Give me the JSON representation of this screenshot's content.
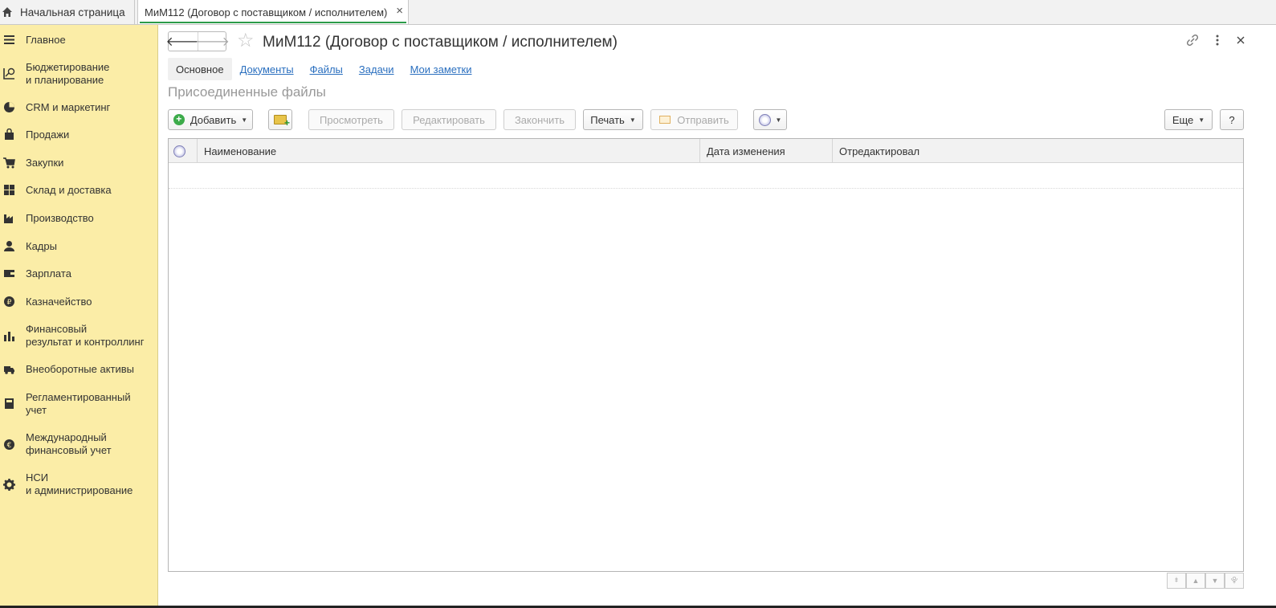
{
  "topbar": {
    "home_tab": "Начальная страница",
    "doc_tab": "МиМ112 (Договор с поставщиком / исполнителем)",
    "close": "×"
  },
  "sidebar": {
    "items": [
      {
        "label": "Главное",
        "icon": "menu-icon"
      },
      {
        "label": "Бюджетирование\nи планирование",
        "icon": "budget-icon"
      },
      {
        "label": "CRM и маркетинг",
        "icon": "pie-chart-icon"
      },
      {
        "label": "Продажи",
        "icon": "shopping-bag-icon"
      },
      {
        "label": "Закупки",
        "icon": "cart-icon"
      },
      {
        "label": "Склад и доставка",
        "icon": "warehouse-icon"
      },
      {
        "label": "Производство",
        "icon": "factory-icon"
      },
      {
        "label": "Кадры",
        "icon": "person-icon"
      },
      {
        "label": "Зарплата",
        "icon": "wallet-icon"
      },
      {
        "label": "Казначейство",
        "icon": "ruble-coin-icon"
      },
      {
        "label": "Финансовый\nрезультат и контроллинг",
        "icon": "bar-chart-icon"
      },
      {
        "label": "Внеоборотные активы",
        "icon": "truck-icon"
      },
      {
        "label": "Регламентированный\nучет",
        "icon": "calculator-icon"
      },
      {
        "label": "Международный\nфинансовый учет",
        "icon": "euro-coin-icon"
      },
      {
        "label": "НСИ\nи администрирование",
        "icon": "gear-icon"
      }
    ]
  },
  "header": {
    "back": "🡐",
    "forward": "🡒",
    "title": "МиМ112 (Договор с поставщиком / исполнителем)"
  },
  "tabs": [
    "Основное",
    "Документы",
    "Файлы",
    "Задачи",
    "Мои заметки"
  ],
  "section_title": "Присоединенные файлы",
  "toolbar": {
    "add": "Добавить",
    "view": "Просмотреть",
    "edit": "Редактировать",
    "finish": "Закончить",
    "print": "Печать",
    "send": "Отправить",
    "more": "Еще",
    "help": "?"
  },
  "grid": {
    "columns": [
      "Наименование",
      "Дата изменения",
      "Отредактировал"
    ]
  }
}
